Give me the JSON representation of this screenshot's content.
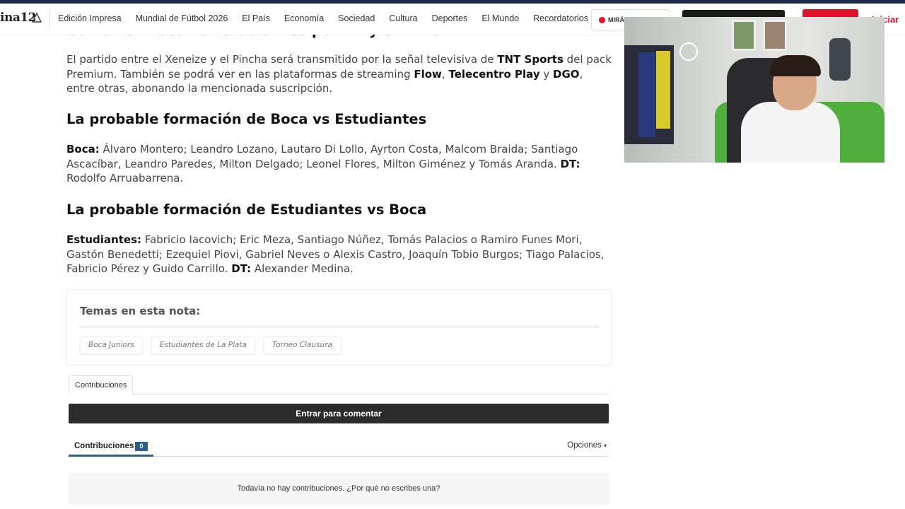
{
  "nav": {
    "logo_text": "ina12",
    "items": [
      "Edición Impresa",
      "Mundial de Fútbol 2026",
      "El País",
      "Economía",
      "Sociedad",
      "Cultura",
      "Deportes",
      "El Mundo",
      "Recordatorios"
    ],
    "live_label": "MIRÁ",
    "login_label": "Iniciar"
  },
  "article": {
    "cut_heading": "Cómo ver Boca vs Estudiantes por TV y en vivo",
    "broadcast": {
      "t1": "El partido entre el Xeneize y el Pincha será transmitido por la señal televisiva de ",
      "b1": "TNT Sports",
      "t2": " del pack Premium. También se podrá ver en las plataformas de streaming ",
      "b2": "Flow",
      "t3": ", ",
      "b3": "Telecentro Play",
      "t4": " y ",
      "b4": "DGO",
      "t5": ", entre otras, abonando la mencionada suscripción."
    },
    "boca_heading": "La probable formación de Boca vs Estudiantes",
    "boca": {
      "b1": "Boca:",
      "t1": " Álvaro Montero; Leandro Lozano, Lautaro Di Lollo, Ayrton Costa, Malcom Braida; Santiago Ascacíbar, Leandro Paredes, Milton Delgado; Leonel Flores, Milton Giménez y Tomás Aranda. ",
      "b2": "DT:",
      "t2": " Rodolfo Arruabarrena."
    },
    "est_heading": "La probable formación de Estudiantes vs Boca",
    "estudiantes": {
      "b1": "Estudiantes:",
      "t1": " Fabricio Iacovich; Eric Meza, Santiago Núñez, Tomás Palacios o Ramiro Funes Mori, Gastón Benedetti; Ezequiel Piovi, Gabriel Neves o Alexis Castro, Joaquín Tobio Burgos; Tiago Palacios, Fabricio Pérez y Guido Carrillo. ",
      "b2": "DT:",
      "t2": " Alexander Medina."
    }
  },
  "tags": {
    "title": "Temas en esta nota:",
    "items": [
      "Boca Juniors",
      "Estudiantes de La Plata",
      "Torneo Clausura"
    ]
  },
  "comments": {
    "tab_label": "Contribuciones",
    "login_button": "Entrar para comentar",
    "count_label": "Contribuciones",
    "count": "0",
    "options_label": "Opciones",
    "empty_text": "Todavía no hay contribuciones. ¿Por qué no escribes una?"
  },
  "colors": {
    "accent_red": "#e0112b",
    "count_blue": "#2c5f8a",
    "dark_button": "#2b2b2b"
  }
}
